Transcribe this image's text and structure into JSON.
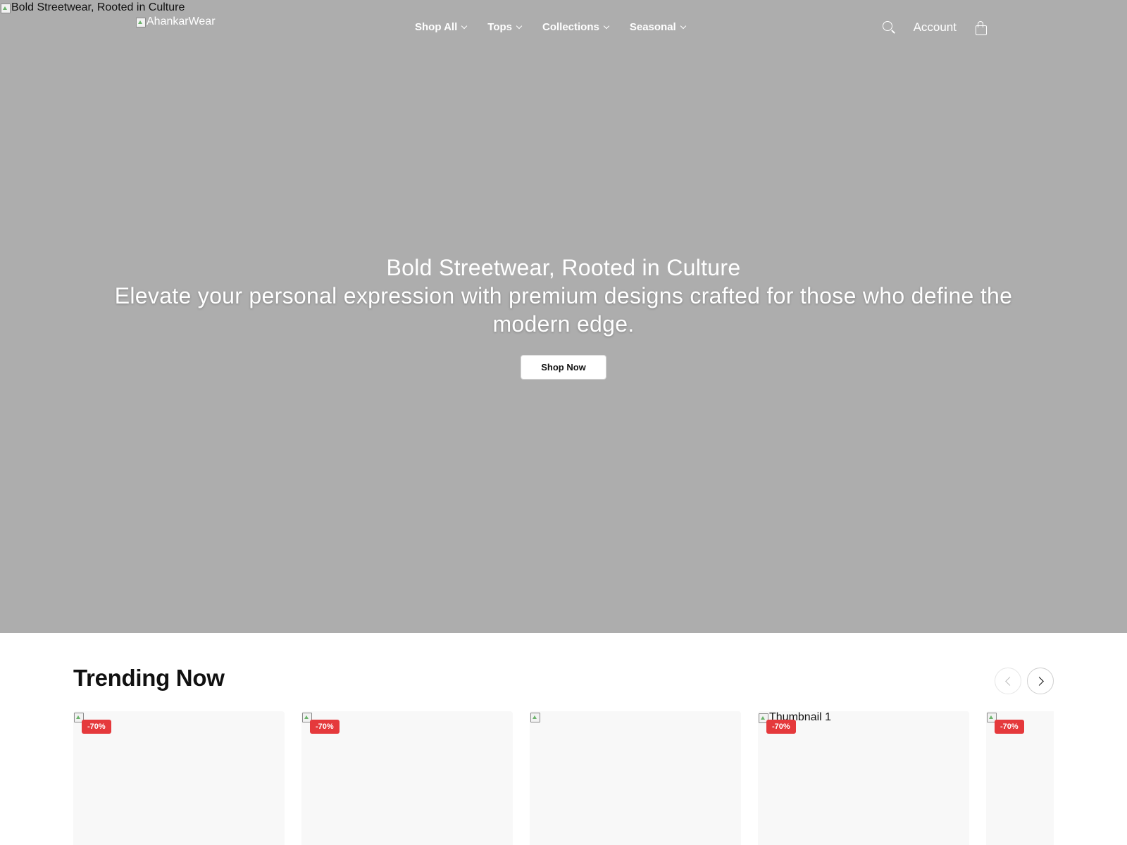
{
  "hero": {
    "image_alt": "Bold Streetwear, Rooted in Culture",
    "title": "Bold Streetwear, Rooted in Culture",
    "subtitle": "Elevate your personal expression with premium designs crafted for those who define the modern edge.",
    "cta_label": "Shop Now",
    "background_color": "#adadad"
  },
  "header": {
    "logo_alt": "AhankarWear",
    "nav": [
      {
        "label": "Shop All"
      },
      {
        "label": "Tops"
      },
      {
        "label": "Collections"
      },
      {
        "label": "Seasonal"
      }
    ],
    "account_label": "Account",
    "search_icon": "search-icon",
    "cart_icon": "bag-icon"
  },
  "trending": {
    "title": "Trending Now",
    "products": [
      {
        "image_alt": "",
        "badge": "-70%"
      },
      {
        "image_alt": "",
        "badge": "-70%"
      },
      {
        "image_alt": "",
        "badge": ""
      },
      {
        "image_alt": "Thumbnail 1",
        "badge": "-70%"
      },
      {
        "image_alt": "",
        "badge": "-70%"
      }
    ]
  },
  "colors": {
    "sale_badge": "#e5393c",
    "card_bg": "#f8f8f8"
  }
}
